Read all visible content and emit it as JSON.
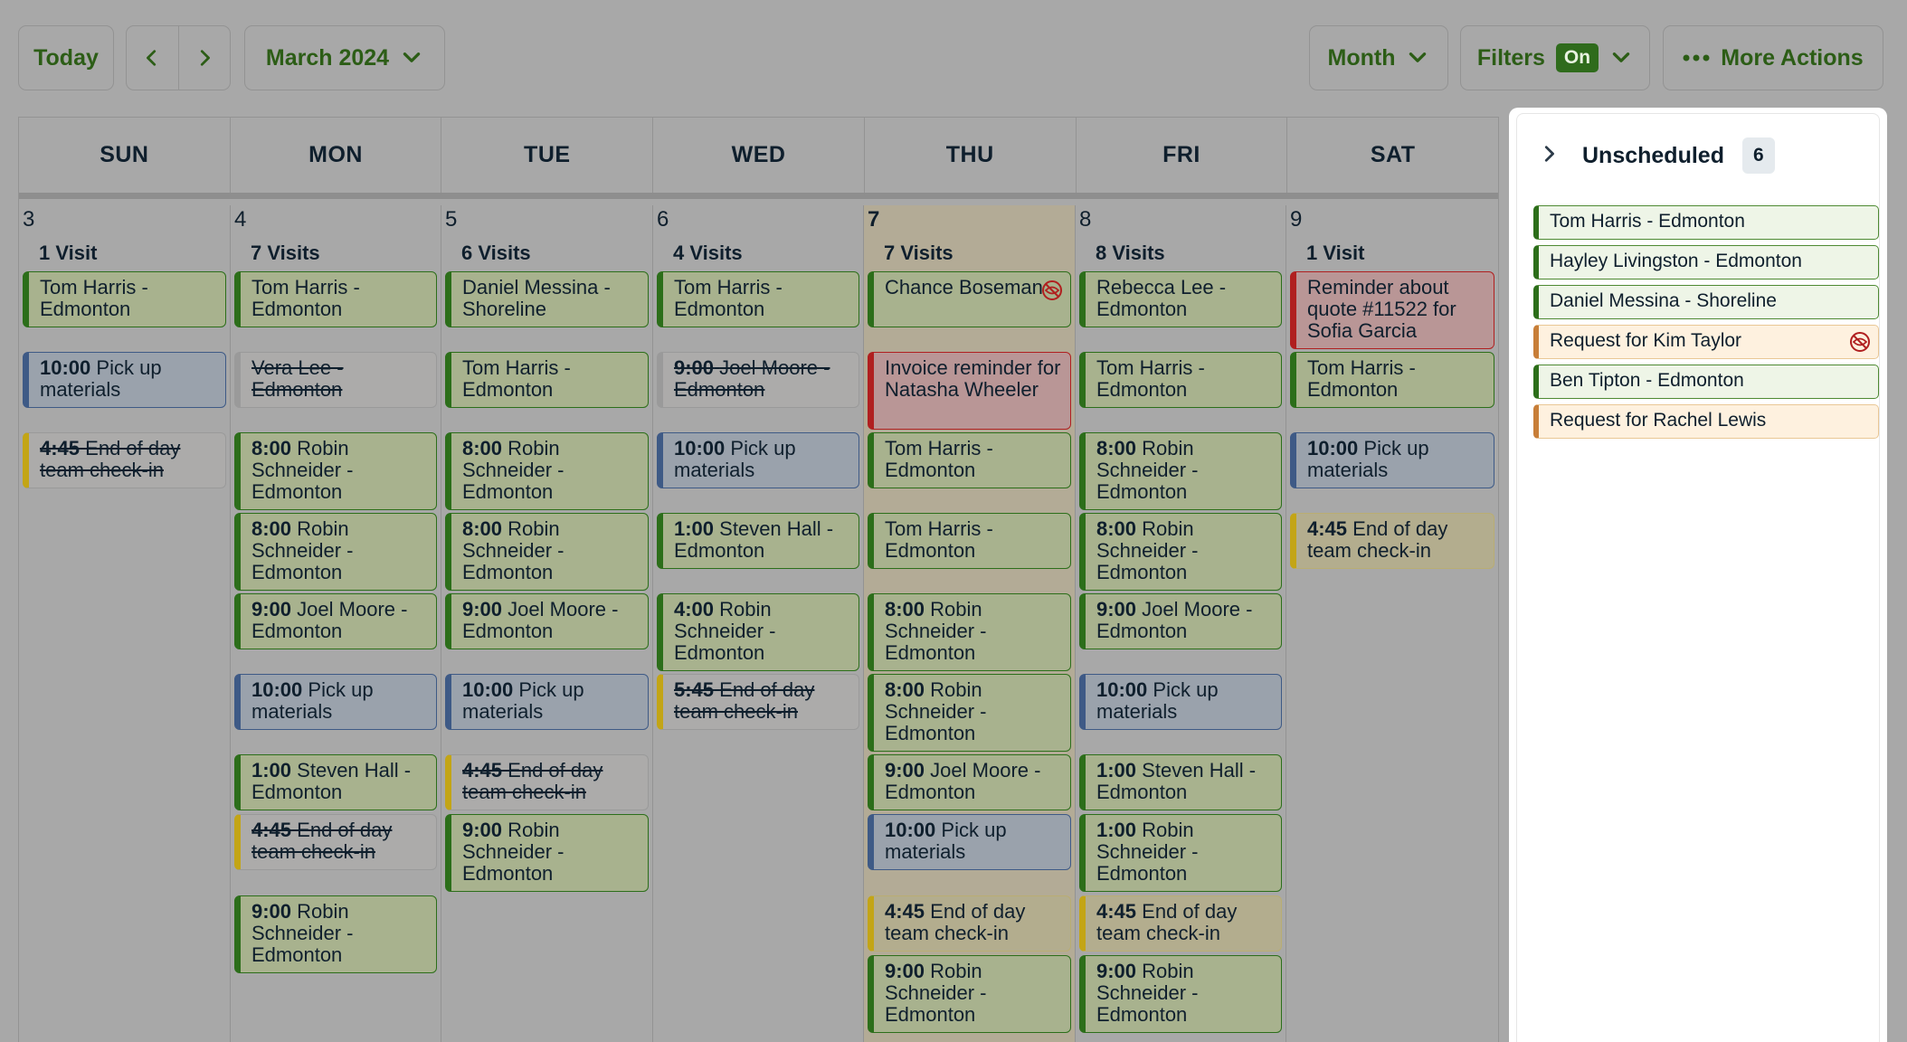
{
  "toolbar": {
    "today_label": "Today",
    "month_label": "March 2024",
    "view_label": "Month",
    "filters_label": "Filters",
    "filters_badge": "On",
    "more_actions_label": "More Actions"
  },
  "weekdays": [
    "SUN",
    "MON",
    "TUE",
    "WED",
    "THU",
    "FRI",
    "SAT"
  ],
  "days": [
    {
      "num": "3",
      "visits": "1 Visit",
      "events": [
        {
          "time": "",
          "title": "Tom Harris - Edmonton"
        },
        {
          "time": "10:00",
          "title": "Pick up materials"
        },
        {
          "time": "4:45",
          "title": "End of day team check-in"
        }
      ]
    },
    {
      "num": "4",
      "visits": "7 Visits",
      "events": [
        {
          "time": "",
          "title": "Tom Harris - Edmonton"
        },
        {
          "time": "",
          "title": "Vera Lee - Edmonton"
        },
        {
          "time": "8:00",
          "title": "Robin Schneider - Edmonton"
        },
        {
          "time": "8:00",
          "title": "Robin Schneider - Edmonton"
        },
        {
          "time": "9:00",
          "title": "Joel Moore - Edmonton"
        },
        {
          "time": "10:00",
          "title": "Pick up materials"
        },
        {
          "time": "1:00",
          "title": "Steven Hall - Edmonton"
        },
        {
          "time": "4:45",
          "title": "End of day team check-in"
        },
        {
          "time": "9:00",
          "title": "Robin Schneider - Edmonton"
        }
      ]
    },
    {
      "num": "5",
      "visits": "6 Visits",
      "events": [
        {
          "time": "",
          "title": "Daniel Messina - Shoreline"
        },
        {
          "time": "",
          "title": "Tom Harris - Edmonton"
        },
        {
          "time": "8:00",
          "title": "Robin Schneider - Edmonton"
        },
        {
          "time": "8:00",
          "title": "Robin Schneider - Edmonton"
        },
        {
          "time": "9:00",
          "title": "Joel Moore - Edmonton"
        },
        {
          "time": "10:00",
          "title": "Pick up materials"
        },
        {
          "time": "4:45",
          "title": "End of day team check-in"
        },
        {
          "time": "9:00",
          "title": "Robin Schneider - Edmonton"
        }
      ]
    },
    {
      "num": "6",
      "visits": "4 Visits",
      "events": [
        {
          "time": "",
          "title": "Tom Harris - Edmonton"
        },
        {
          "time": "9:00",
          "title": "Joel Moore - Edmonton"
        },
        {
          "time": "10:00",
          "title": "Pick up materials"
        },
        {
          "time": "1:00",
          "title": "Steven Hall - Edmonton"
        },
        {
          "time": "4:00",
          "title": "Robin Schneider - Edmonton"
        },
        {
          "time": "5:45",
          "title": "End of day team check-in"
        }
      ]
    },
    {
      "num": "7",
      "visits": "7 Visits",
      "events": [
        {
          "time": "",
          "title": "Chance Boseman"
        },
        {
          "time": "",
          "title": "Invoice reminder for Natasha Wheeler"
        },
        {
          "time": "",
          "title": "Tom Harris - Edmonton"
        },
        {
          "time": "",
          "title": "Tom Harris - Edmonton"
        },
        {
          "time": "8:00",
          "title": "Robin Schneider - Edmonton"
        },
        {
          "time": "8:00",
          "title": "Robin Schneider - Edmonton"
        },
        {
          "time": "9:00",
          "title": "Joel Moore - Edmonton"
        },
        {
          "time": "10:00",
          "title": "Pick up materials"
        },
        {
          "time": "4:45",
          "title": "End of day team check-in"
        },
        {
          "time": "9:00",
          "title": "Robin Schneider - Edmonton"
        }
      ]
    },
    {
      "num": "8",
      "visits": "8 Visits",
      "events": [
        {
          "time": "",
          "title": "Rebecca Lee - Edmonton"
        },
        {
          "time": "",
          "title": "Tom Harris - Edmonton"
        },
        {
          "time": "8:00",
          "title": "Robin Schneider - Edmonton"
        },
        {
          "time": "8:00",
          "title": "Robin Schneider - Edmonton"
        },
        {
          "time": "9:00",
          "title": "Joel Moore - Edmonton"
        },
        {
          "time": "10:00",
          "title": "Pick up materials"
        },
        {
          "time": "1:00",
          "title": "Steven Hall - Edmonton"
        },
        {
          "time": "1:00",
          "title": "Robin Schneider - Edmonton"
        },
        {
          "time": "4:45",
          "title": "End of day team check-in"
        },
        {
          "time": "9:00",
          "title": "Robin Schneider - Edmonton"
        }
      ]
    },
    {
      "num": "9",
      "visits": "1 Visit",
      "events": [
        {
          "time": "",
          "title": "Reminder about quote #11522 for Sofia Garcia"
        },
        {
          "time": "",
          "title": "Tom Harris - Edmonton"
        },
        {
          "time": "10:00",
          "title": "Pick up materials"
        },
        {
          "time": "4:45",
          "title": "End of day team check-in"
        }
      ]
    }
  ],
  "unscheduled": {
    "title": "Unscheduled",
    "count": "6",
    "items": [
      "Tom Harris - Edmonton",
      "Hayley Livingston - Edmonton",
      "Daniel Messina - Shoreline",
      "Request for Kim Taylor",
      "Ben Tipton - Edmonton",
      "Request for Rachel Lewis"
    ]
  },
  "colors": {
    "brand_green": "#2c6e1a",
    "visit_blue": "#3e5a86",
    "reminder_red": "#b01f1f",
    "task_yellow": "#c3a516",
    "request_orange": "#c87e38"
  },
  "icons": [
    "chevron-left-icon",
    "chevron-right-icon",
    "chevron-down-icon",
    "more-dots-icon",
    "hidden-eye-icon"
  ]
}
